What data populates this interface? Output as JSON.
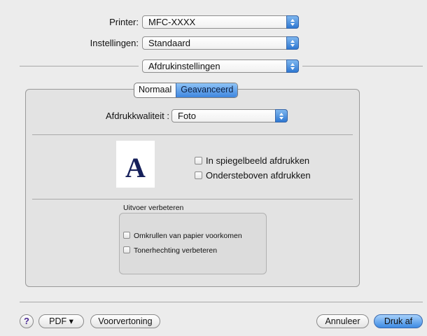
{
  "printer": {
    "label": "Printer:",
    "value": "MFC-XXXX"
  },
  "settings": {
    "label": "Instellingen:",
    "value": "Standaard"
  },
  "panel_select": {
    "value": "Afdrukinstellingen"
  },
  "tabs": [
    {
      "label": "Normaal",
      "active": false
    },
    {
      "label": "Geavanceerd",
      "active": true
    }
  ],
  "quality": {
    "label": "Afdrukkwaliteit :",
    "value": "Foto"
  },
  "preview_letter": "A",
  "mirror_checkbox": {
    "label": "In spiegelbeeld afdrukken",
    "checked": false
  },
  "upsidedown_checkbox": {
    "label": "Ondersteboven afdrukken",
    "checked": false
  },
  "improve_group": {
    "title": "Uitvoer verbeteren",
    "options": [
      {
        "label": "Omkrullen van papier voorkomen",
        "checked": false
      },
      {
        "label": "Tonerhechting verbeteren",
        "checked": false
      }
    ]
  },
  "footer": {
    "help": "?",
    "pdf": "PDF ▾",
    "preview": "Voorvertoning",
    "cancel": "Annuleer",
    "print": "Druk af"
  },
  "colors": {
    "accent": "#3d8ae3",
    "dialog_bg": "#ececec"
  },
  "icons": {
    "popup_arrows": "updown-arrows-icon",
    "help": "question-icon"
  }
}
